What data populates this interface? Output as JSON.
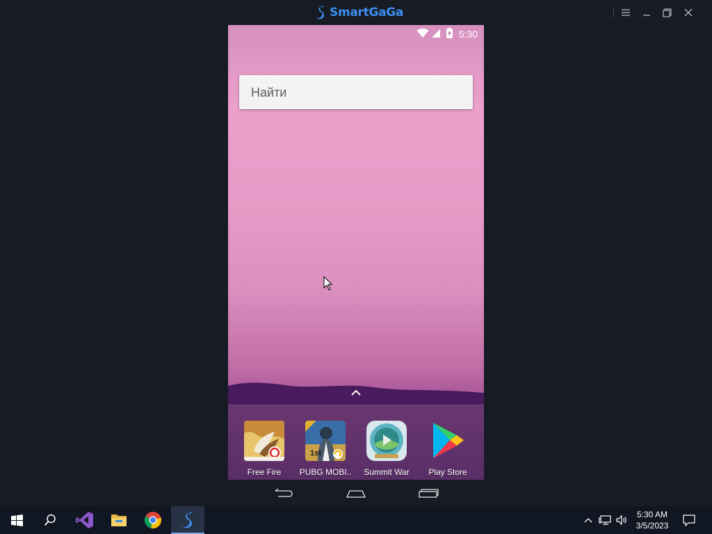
{
  "window": {
    "title": "SmartGaGa",
    "accent": "#3d8ef0",
    "controls": [
      "menu-icon",
      "minimize-icon",
      "restore-icon",
      "close-icon"
    ]
  },
  "android": {
    "status": {
      "time": "5:30",
      "icons": [
        "wifi-icon",
        "signal-icon",
        "battery-charging-icon"
      ]
    },
    "search": {
      "placeholder": "Найти"
    },
    "dock": [
      {
        "label": "Free Fire",
        "icon": "free-fire-icon"
      },
      {
        "label": "PUBG MOBI..",
        "icon": "pubg-mobile-icon"
      },
      {
        "label": "Summit War",
        "icon": "summit-war-icon"
      },
      {
        "label": "Play Store",
        "icon": "play-store-icon"
      }
    ],
    "navigation": [
      "back-icon",
      "home-icon",
      "recents-icon"
    ]
  },
  "taskbar": {
    "pinned": [
      "start-icon",
      "search-icon",
      "visual-studio-icon",
      "file-explorer-icon",
      "chrome-icon",
      "smartgaga-icon"
    ],
    "active": "smartgaga-icon",
    "tray": {
      "time": "5:30 AM",
      "date": "3/5/2023",
      "icons": [
        "chevron-up-icon",
        "network-icon",
        "volume-icon",
        "notification-icon"
      ]
    }
  }
}
